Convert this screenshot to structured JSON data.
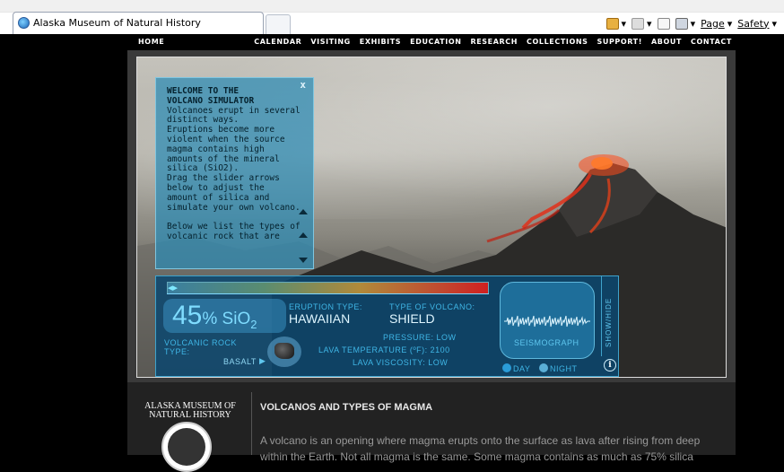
{
  "browser": {
    "tab_title": "Alaska Museum of Natural History",
    "commands": {
      "page": "Page",
      "safety": "Safety"
    },
    "icons": [
      "home-icon",
      "rss-feeds-icon",
      "read-mail-icon",
      "print-icon"
    ]
  },
  "nav": {
    "items": [
      "HOME",
      "CALENDAR",
      "VISITING",
      "EXHIBITS",
      "EDUCATION",
      "RESEARCH",
      "COLLECTIONS",
      "SUPPORT!",
      "ABOUT",
      "CONTACT"
    ]
  },
  "welcome": {
    "close": "x",
    "title_line1": "WELCOME TO THE",
    "title_line2": "VOLCANO SIMULATOR",
    "body": [
      "Volcanoes erupt in several",
      "distinct ways.",
      "Eruptions become more",
      "violent when the source",
      "magma contains high",
      "amounts of the mineral",
      "silica (SiO2).",
      "Drag the slider arrows",
      "below to adjust the",
      "amount of silica and",
      "simulate your own volcano.",
      "",
      "Below we list the types of",
      "volcanic rock that are"
    ]
  },
  "simulator": {
    "silica_percent": 45,
    "sio2_number": "45",
    "sio2_unit": "% SiO",
    "sio2_sub": "2",
    "eruption_type_label": "ERUPTION TYPE:",
    "eruption_type_value": "HAWAIIAN",
    "volcano_type_label": "TYPE OF VOLCANO:",
    "volcano_type_value": "SHIELD",
    "rock_label_1": "VOLCANIC ROCK",
    "rock_label_2": "TYPE:",
    "rock_value": "BASALT",
    "pressure": "PRESSURE: LOW",
    "lava_temp": "LAVA TEMPERATURE (ºF): 2100",
    "lava_visc": "LAVA VISCOSITY: LOW",
    "seismograph": "SEISMOGRAPH",
    "show_hide": "SHOW/HIDE",
    "day": "DAY",
    "night": "NIGHT",
    "info": "i"
  },
  "content": {
    "logo_line1": "ALASKA MUSEUM OF",
    "logo_line2": "NATURAL HISTORY",
    "heading": "VOLCANOS AND TYPES OF MAGMA",
    "para_line1": "A volcano is an opening where magma erupts onto the surface as lava after rising from deep",
    "para_line2": "within the Earth. Not all magma is the same. Some magma contains as much as 75% silica"
  },
  "colors": {
    "accent": "#3fb6e6",
    "lava": "#e03a1a",
    "panel": "#0a466e"
  }
}
